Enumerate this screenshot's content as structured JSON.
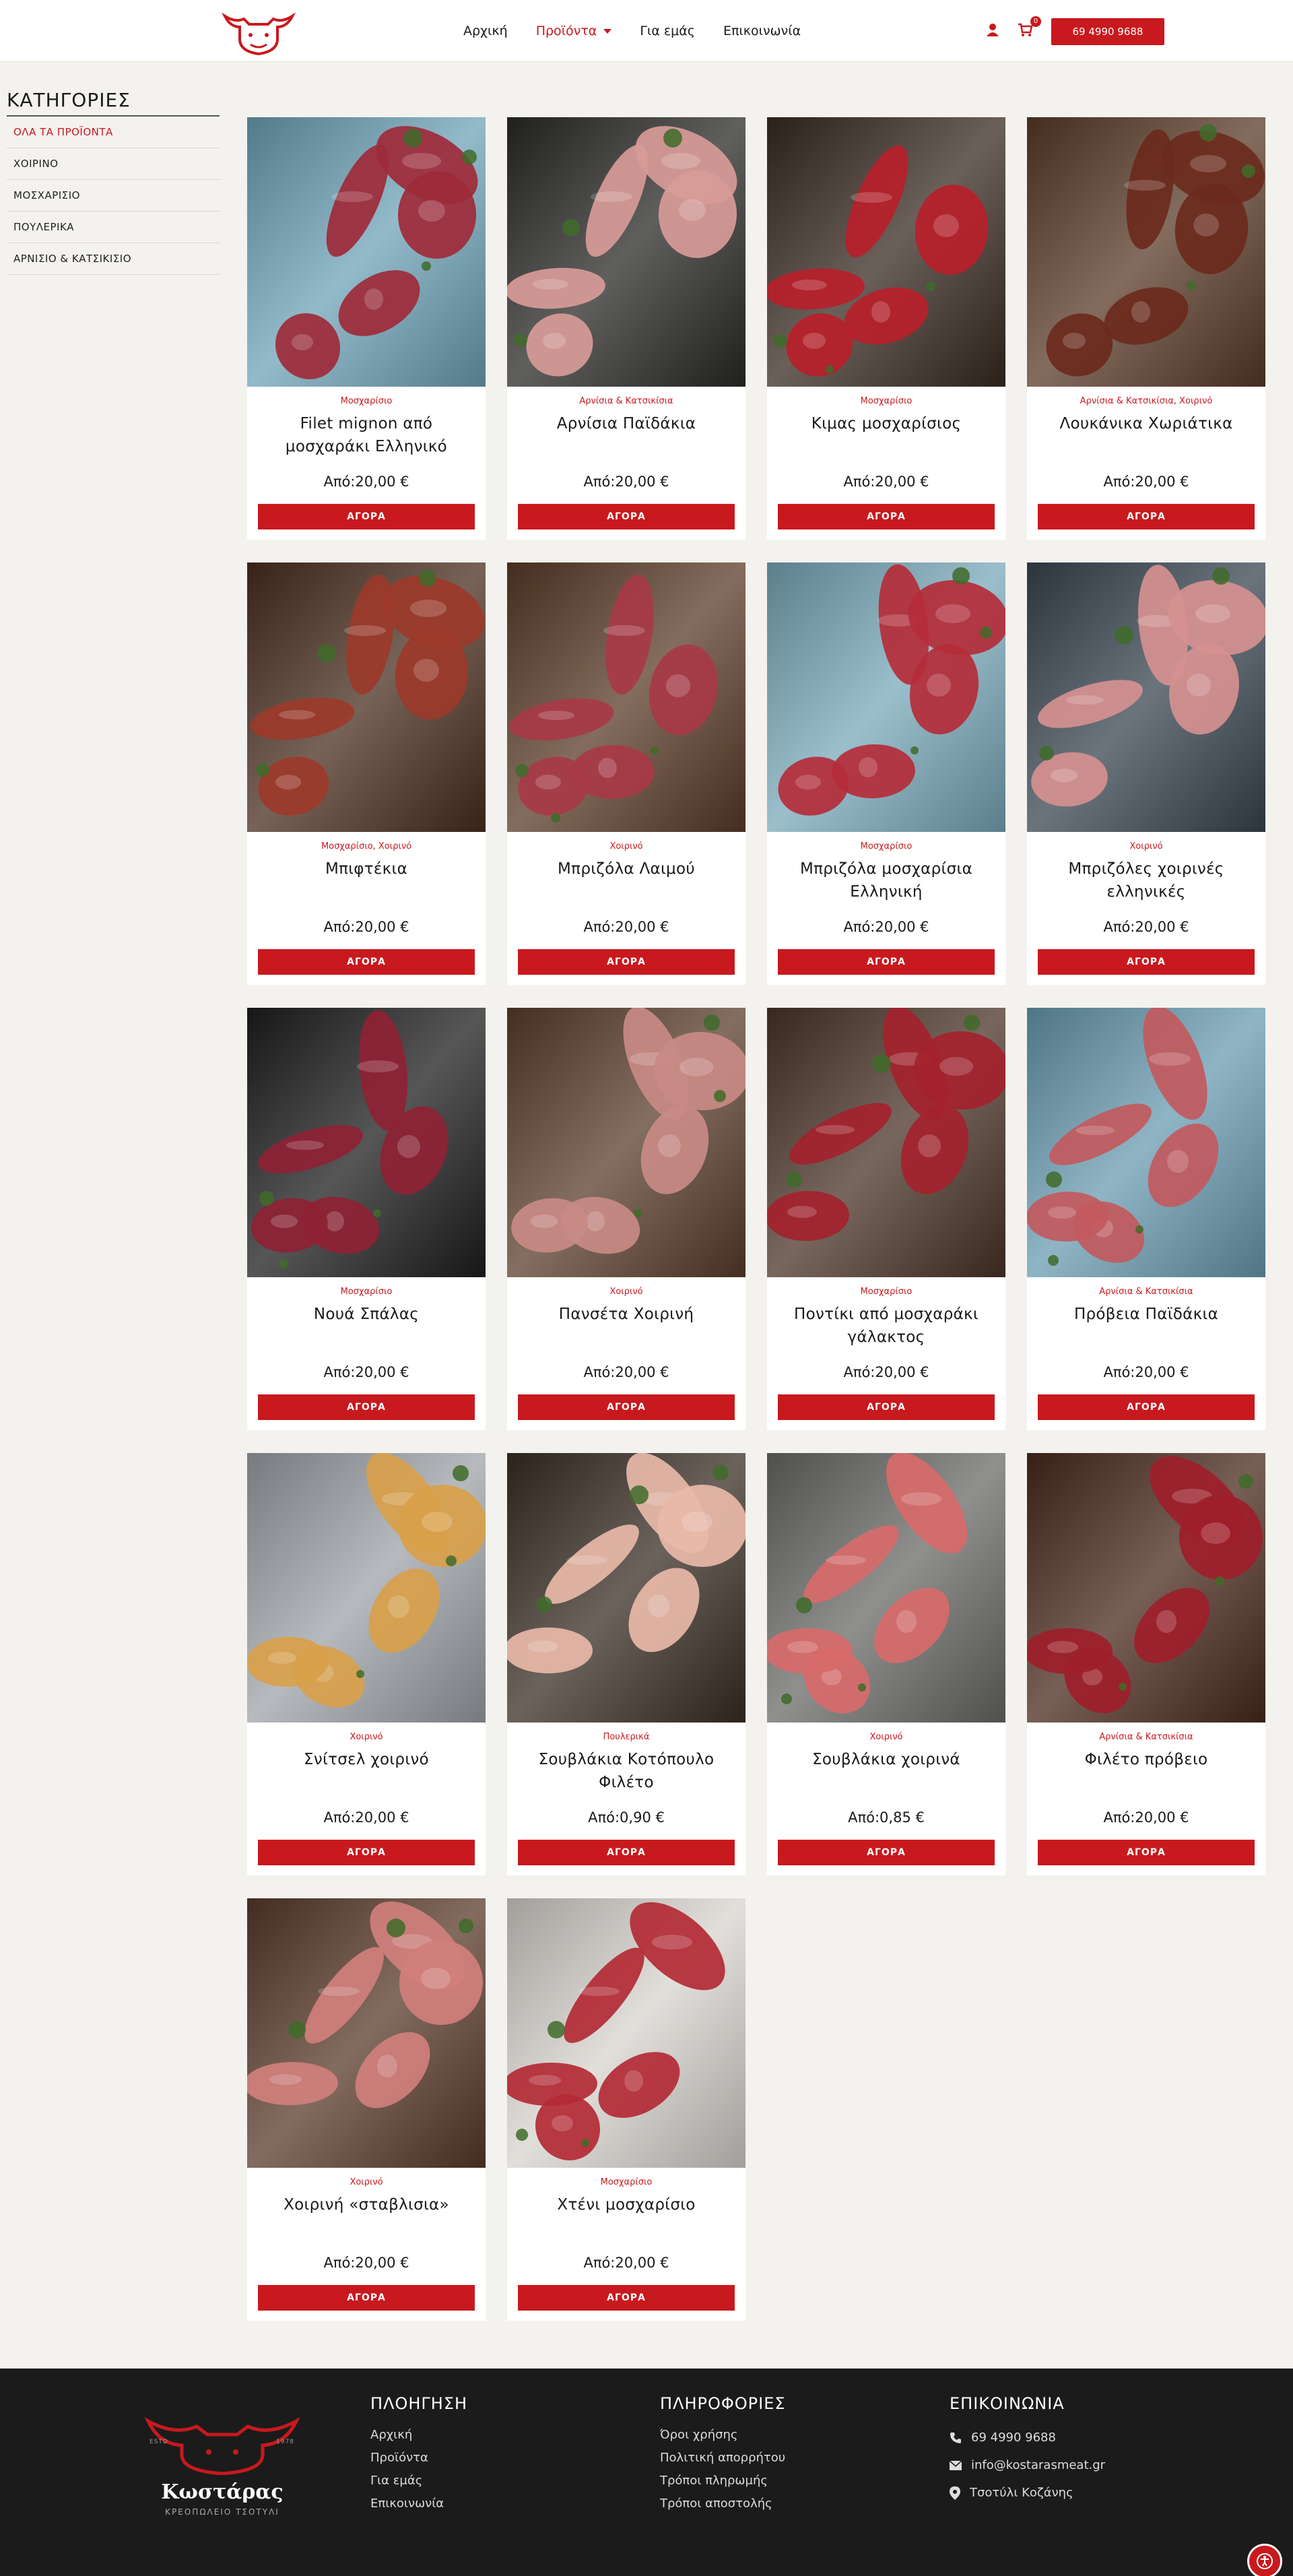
{
  "header": {
    "nav": [
      {
        "label": "Αρχική"
      },
      {
        "label": "Προϊόντα"
      },
      {
        "label": "Για εμάς"
      },
      {
        "label": "Επικοινωνία"
      }
    ],
    "cart_count": "0",
    "phone": "69 4990 9688"
  },
  "sidebar": {
    "title": "ΚΑΤΗΓΟΡΙΕΣ",
    "items": [
      {
        "label": "ΟΛΑ ΤΑ ΠΡΟΪΟΝΤΑ"
      },
      {
        "label": "ΧΟΙΡΙΝΟ"
      },
      {
        "label": "ΜΟΣΧΑΡΙΣΙΟ"
      },
      {
        "label": "ΠΟΥΛΕΡΙΚΑ"
      },
      {
        "label": "ΑΡΝΙΣΙΟ & ΚΑΤΣΙΚΙΣΙΟ"
      }
    ]
  },
  "products": [
    {
      "category": "Μοσχαρίσιο",
      "name": "Filet mignon από μοσχαράκι Ελληνικό",
      "price": "Από:20,00 €",
      "button": "ΑΓΟΡΑ",
      "bg": "#6fa3b8",
      "meat": "#9e2a3a"
    },
    {
      "category": "Αρνίσια & Κατσικίσια",
      "name": "Αρνίσια Παϊδάκια",
      "price": "Από:20,00 €",
      "button": "ΑΓΟΡΑ",
      "bg": "#2b2a28",
      "meat": "#d89b98"
    },
    {
      "category": "Μοσχαρίσιο",
      "name": "Κιμας μοσχαρίσιος",
      "price": "Από:20,00 €",
      "button": "ΑΓΟΡΑ",
      "bg": "#3a2a22",
      "meat": "#b8202a"
    },
    {
      "category": "Αρνίσια & Κατσικίσια, Χοιρινό",
      "name": "Λουκάνικα Χωριάτικα",
      "price": "Από:20,00 €",
      "button": "ΑΓΟΡΑ",
      "bg": "#5a3a28",
      "meat": "#6b2a1c"
    },
    {
      "category": "Μοσχαρίσιο, Χοιρινό",
      "name": "Μπιφτέκια",
      "price": "Από:20,00 €",
      "button": "ΑΓΟΡΑ",
      "bg": "#4a2e20",
      "meat": "#9c3a2a"
    },
    {
      "category": "Χοιρινό",
      "name": "Μπριζόλα Λαιμού",
      "price": "Από:20,00 €",
      "button": "ΑΓΟΡΑ",
      "bg": "#5b3b28",
      "meat": "#a83a48"
    },
    {
      "category": "Μοσχαρίσιο",
      "name": "Μπριζόλα μοσχαρίσια Ελληνική",
      "price": "Από:20,00 €",
      "button": "ΑΓΟΡΑ",
      "bg": "#7aa9bb",
      "meat": "#b52c3a"
    },
    {
      "category": "Χοιρινό",
      "name": "Μπριζόλες χοιρινές ελληνικές",
      "price": "Από:20,00 €",
      "button": "ΑΓΟΡΑ",
      "bg": "#3a4652",
      "meat": "#d69090"
    },
    {
      "category": "Μοσχαρίσιο",
      "name": "Νουά Σπάλας",
      "price": "Από:20,00 €",
      "button": "ΑΓΟΡΑ",
      "bg": "#1e1e1e",
      "meat": "#8e2234"
    },
    {
      "category": "Χοιρινό",
      "name": "Πανσέτα Χοιρινή",
      "price": "Από:20,00 €",
      "button": "ΑΓΟΡΑ",
      "bg": "#5a3e2c",
      "meat": "#c98a86"
    },
    {
      "category": "Μοσχαρίσιο",
      "name": "Ποντίκι από μοσχαράκι γάλακτος",
      "price": "Από:20,00 €",
      "button": "ΑΓΟΡΑ",
      "bg": "#4b3428",
      "meat": "#a4222e"
    },
    {
      "category": "Αρνίσια & Κατσικίσια",
      "name": "Πρόβεια Παϊδάκια",
      "price": "Από:20,00 €",
      "button": "ΑΓΟΡΑ",
      "bg": "#6a9cb2",
      "meat": "#c25a5e"
    },
    {
      "category": "Χοιρινό",
      "name": "Σνίτσελ χοιρινό",
      "price": "Από:20,00 €",
      "button": "ΑΓΟΡΑ",
      "bg": "#9ea3a8",
      "meat": "#d9a04a"
    },
    {
      "category": "Πουλερικά",
      "name": "Σουβλάκια Κοτόπουλο Φιλέτο",
      "price": "Από:0,90 €",
      "button": "ΑΓΟΡΑ",
      "bg": "#3a2e26",
      "meat": "#e8b8a8"
    },
    {
      "category": "Χοιρινό",
      "name": "Σουβλάκια χοιρινά",
      "price": "Από:0,85 €",
      "button": "ΑΓΟΡΑ",
      "bg": "#6a6a68",
      "meat": "#d86a6a"
    },
    {
      "category": "Αρνίσια & Κατσικίσια",
      "name": "Φιλέτο πρόβειο",
      "price": "Από:20,00 €",
      "button": "ΑΓΟΡΑ",
      "bg": "#4a2a1e",
      "meat": "#9e1e2a"
    },
    {
      "category": "Χοιρινό",
      "name": "Χοιρινή «σταβλισια»",
      "price": "Από:20,00 €",
      "button": "ΑΓΟΡΑ",
      "bg": "#5a3a2a",
      "meat": "#d07f7c"
    },
    {
      "category": "Μοσχαρίσιο",
      "name": "Χτένι μοσχαρίσιο",
      "price": "Από:20,00 €",
      "button": "ΑΓΟΡΑ",
      "bg": "#d8d4cf",
      "meat": "#b32a35"
    }
  ],
  "footer": {
    "brand": {
      "name": "Κωστάρας",
      "tagline": "ΚΡΕΟΠΩΛΕΙΟ ΤΣΟΤΥΛΙ",
      "est": "ESTD",
      "year": "1978"
    },
    "nav_title": "ΠΛΟΗΓΗΣΗ",
    "nav_links": [
      {
        "label": "Αρχική"
      },
      {
        "label": "Προϊόντα"
      },
      {
        "label": "Για εμάς"
      },
      {
        "label": "Επικοινωνία"
      }
    ],
    "info_title": "ΠΛΗΡΟΦΟΡΙΕΣ",
    "info_links": [
      {
        "label": "Όροι χρήσης"
      },
      {
        "label": "Πολιτική απορρήτου"
      },
      {
        "label": "Τρόποι πληρωμής"
      },
      {
        "label": "Τρόποι αποστολής"
      }
    ],
    "contact_title": "ΕΠΙΚΟΙΝΩΝΙΑ",
    "contact": {
      "phone": "69 4990 9688",
      "email": "info@kostarasmeat.gr",
      "address": "Τσοτύλι Κοζάνης"
    }
  },
  "colors": {
    "accent": "#c8191e",
    "footer_bg": "#1b1b1b",
    "page_bg": "#f4f2ee"
  }
}
